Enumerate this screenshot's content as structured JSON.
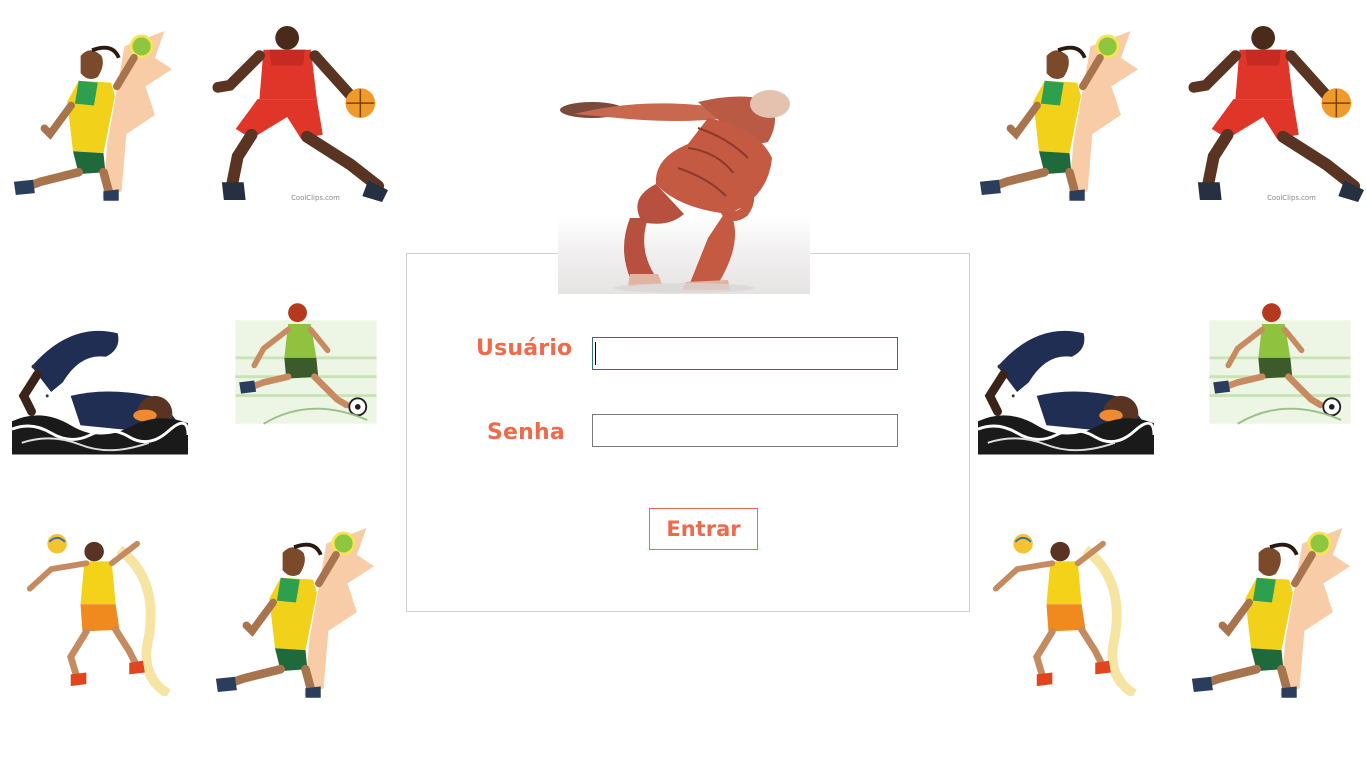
{
  "login": {
    "user_label": "Usuário",
    "password_label": "Senha",
    "user_value": "",
    "password_value": "",
    "submit_label": "Entrar"
  },
  "theme": {
    "accent": "#ee6a4c",
    "input_focus_border": "#2f6f7e",
    "panel_border": "#d0d0d0"
  },
  "illustrations": {
    "watermark": "CoolClips.com",
    "tiles": [
      "handball-player-illustration",
      "basketball-player-illustration",
      "swimmer-illustration",
      "soccer-player-illustration",
      "volleyball-player-illustration",
      "handball-player-illustration",
      "handball-player-illustration",
      "basketball-player-illustration",
      "swimmer-illustration",
      "soccer-player-illustration",
      "volleyball-player-illustration",
      "handball-player-illustration"
    ],
    "hero": "discus-thrower-anatomy-illustration"
  }
}
